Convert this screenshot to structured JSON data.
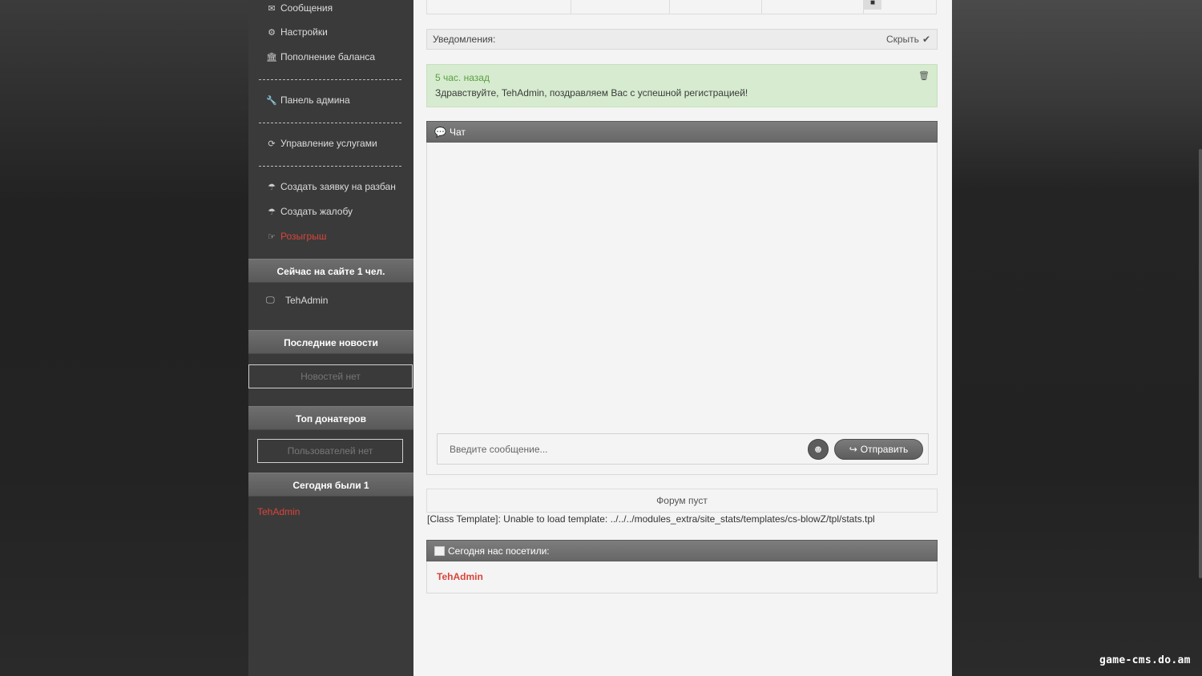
{
  "sidebar": {
    "menu": {
      "messages": "Сообщения",
      "settings": "Настройки",
      "balance": "Пополнение баланса",
      "admin_panel": "Панель админа",
      "services": "Управление услугами",
      "unban": "Создать заявку на разбан",
      "complaint": "Создать жалобу",
      "giveaway": "Розыгрыш"
    },
    "online": {
      "title": "Сейчас на сайте 1 чел.",
      "user": "TehAdmin"
    },
    "news": {
      "title": "Последние новости",
      "empty": "Новостей нет"
    },
    "donators": {
      "title": "Топ донатеров",
      "empty": "Пользователей нет"
    },
    "today": {
      "title": "Сегодня были 1",
      "user": "TehAdmin"
    }
  },
  "main": {
    "notifications": {
      "label": "Уведомления:",
      "hide": "Скрыть"
    },
    "notice": {
      "time": "5 час. назад",
      "message": "Здравствуйте, TehAdmin, поздравляем Вас с успешной регистрацией!"
    },
    "chat": {
      "title": "Чат",
      "placeholder": "Введите сообщение...",
      "send": "Отправить"
    },
    "forum": {
      "empty": "Форум пуст"
    },
    "template_error": "[Class Template]: Unable to load template: ../../../modules_extra/site_stats/templates/cs-blowZ/tpl/stats.tpl",
    "visitors": {
      "title": "Сегодня нас посетили:",
      "user": "TehAdmin"
    }
  },
  "watermark": "game-cms.do.am",
  "colors": {
    "accent_red": "#d9453a",
    "notice_green": "#5c9e44",
    "notice_bg": "#d6ebcf",
    "sidebar_bg": "#3a3a3a",
    "main_bg": "#f4f4f4"
  },
  "icons": {
    "messages": "envelope-icon",
    "settings": "gears-icon",
    "balance": "bank-icon",
    "admin_panel": "wrench-icon",
    "services": "refresh-icon",
    "unban": "umbrella-icon",
    "complaint": "umbrella-icon",
    "giveaway": "hand-point-icon",
    "online_user": "monitor-icon",
    "chat": "comment-icon",
    "hide": "check-icon",
    "delete": "trash-icon",
    "emoji": "smile-icon",
    "send": "share-icon",
    "top_table": "video-camera-icon"
  }
}
